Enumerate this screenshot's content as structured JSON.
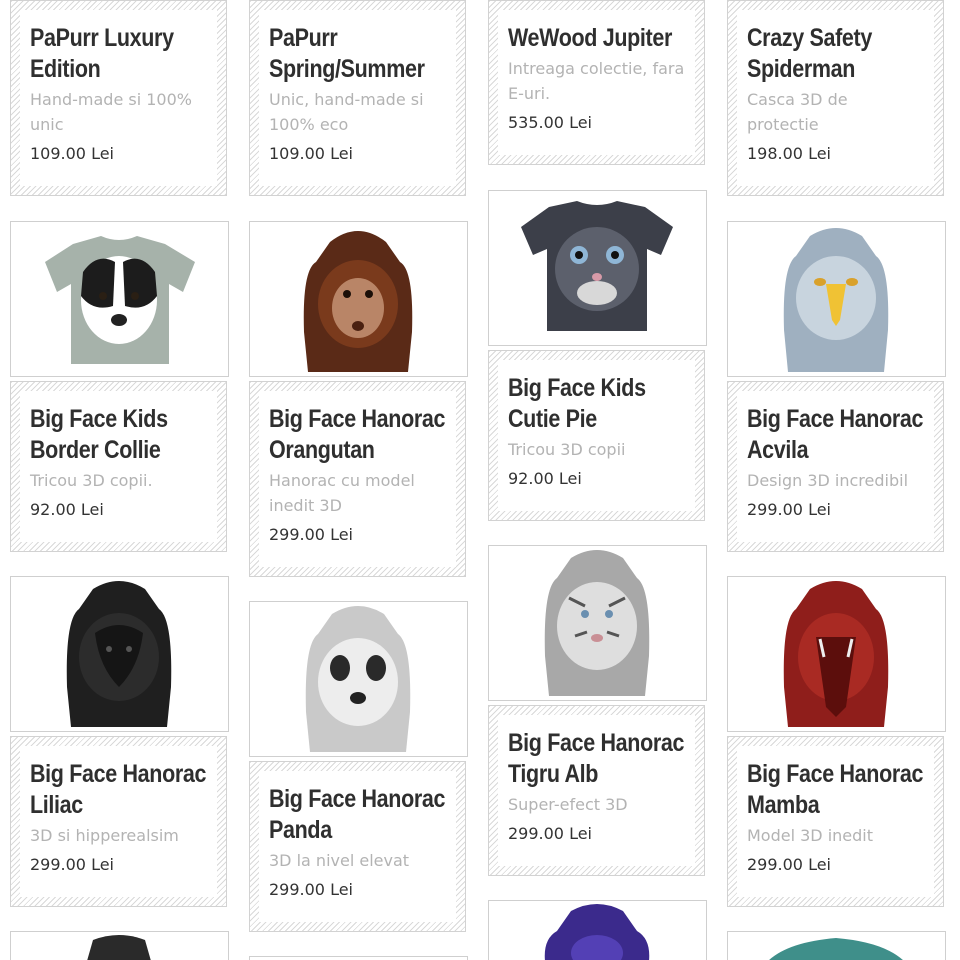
{
  "currency": "Lei",
  "products": [
    {
      "title": "PaPurr Luxury Edition",
      "desc": "Hand-made si 100% unic",
      "price": "109.00 Lei"
    },
    {
      "title": "PaPurr Spring/Summer",
      "desc": "Unic, hand-made si 100% eco",
      "price": "109.00 Lei"
    },
    {
      "title": "WeWood Jupiter",
      "desc": "Intreaga colectie, fara E-uri.",
      "price": "535.00 Lei"
    },
    {
      "title": "Crazy Safety Spiderman",
      "desc": "Casca 3D de protectie",
      "price": "198.00 Lei"
    },
    {
      "title": "Big Face Kids Border Collie",
      "desc": "Tricou 3D copii.",
      "price": "92.00 Lei",
      "image": "border-collie-tshirt-image"
    },
    {
      "title": "Big Face Hanorac Orangutan",
      "desc": "Hanorac cu model inedit 3D",
      "price": "299.00 Lei",
      "image": "orangutan-hoodie-image"
    },
    {
      "title": "Big Face Kids Cutie Pie",
      "desc": "Tricou 3D copii",
      "price": "92.00 Lei",
      "image": "kitten-tshirt-image"
    },
    {
      "title": "Big Face Hanorac Acvila",
      "desc": "Design 3D incredibil",
      "price": "299.00 Lei",
      "image": "eagle-hoodie-image"
    },
    {
      "title": "Big Face Hanorac Liliac",
      "desc": "3D si hipperealsim",
      "price": "299.00 Lei",
      "image": "bat-hoodie-image"
    },
    {
      "title": "Big Face Hanorac Panda",
      "desc": "3D la nivel elevat",
      "price": "299.00 Lei",
      "image": "panda-hoodie-image"
    },
    {
      "title": "Big Face Hanorac Tigru Alb",
      "desc": "Super-efect 3D",
      "price": "299.00 Lei",
      "image": "white-tiger-hoodie-image"
    },
    {
      "title": "Big Face Hanorac Mamba",
      "desc": "Model 3D inedit",
      "price": "299.00 Lei",
      "image": "mamba-hoodie-image"
    }
  ],
  "colors": {
    "hatch": "#d9d9d9",
    "title": "#2f2f2f",
    "desc": "#b3b3b3",
    "price": "#333333",
    "border": "#d2d2d2"
  }
}
